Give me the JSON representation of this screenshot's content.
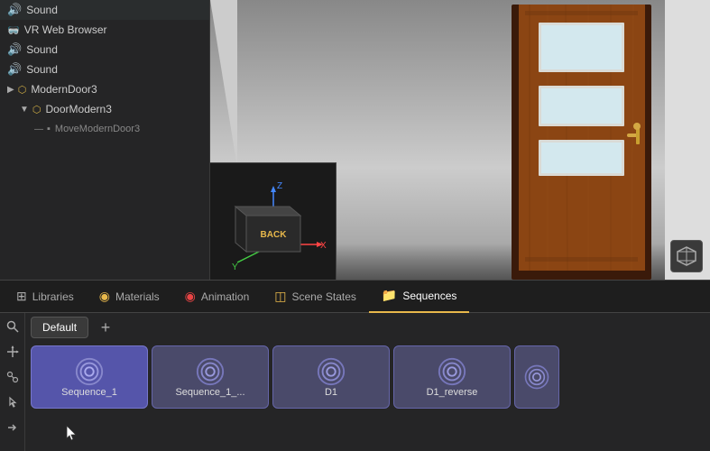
{
  "sidebar": {
    "items": [
      {
        "label": "Sound",
        "indent": 0,
        "icon": "sound",
        "id": "sound-1"
      },
      {
        "label": "VR Web Browser",
        "indent": 0,
        "icon": "vr",
        "id": "vr-web"
      },
      {
        "label": "Sound",
        "indent": 0,
        "icon": "sound",
        "id": "sound-2"
      },
      {
        "label": "Sound",
        "indent": 0,
        "icon": "sound",
        "id": "sound-3"
      },
      {
        "label": "ModernDoor3",
        "indent": 0,
        "icon": "mesh",
        "id": "modern-door"
      },
      {
        "label": "DoorModern3",
        "indent": 1,
        "icon": "mesh",
        "id": "door-modern"
      },
      {
        "label": "MoveModernDoor3",
        "indent": 2,
        "icon": "mesh",
        "id": "move-modern"
      }
    ]
  },
  "tabs": [
    {
      "label": "Libraries",
      "icon": "grid",
      "active": false
    },
    {
      "label": "Materials",
      "icon": "circle",
      "active": false
    },
    {
      "label": "Animation",
      "icon": "circle-red",
      "active": false
    },
    {
      "label": "Scene States",
      "icon": "circle-orange",
      "active": false
    },
    {
      "label": "Sequences",
      "icon": "folder",
      "active": true
    }
  ],
  "toolbar_buttons": [
    "search",
    "axis",
    "clip",
    "pointer",
    "arrow"
  ],
  "sequences_tab": {
    "default_label": "Default",
    "add_label": "+",
    "cards": [
      {
        "label": "Sequence_1",
        "id": "seq1"
      },
      {
        "label": "Sequence_1_...",
        "id": "seq2"
      },
      {
        "label": "D1",
        "id": "seq3"
      },
      {
        "label": "D1_reverse",
        "id": "seq4"
      },
      {
        "label": "",
        "id": "seq5",
        "partial": true
      }
    ]
  },
  "viewport_corner_btn": "⬛",
  "colors": {
    "accent": "#e8b84b",
    "sidebar_bg": "#252526",
    "tab_active_border": "#e8b84b",
    "seq_card_bg": "#4a4a6a",
    "seq_card_active": "#5555aa"
  }
}
